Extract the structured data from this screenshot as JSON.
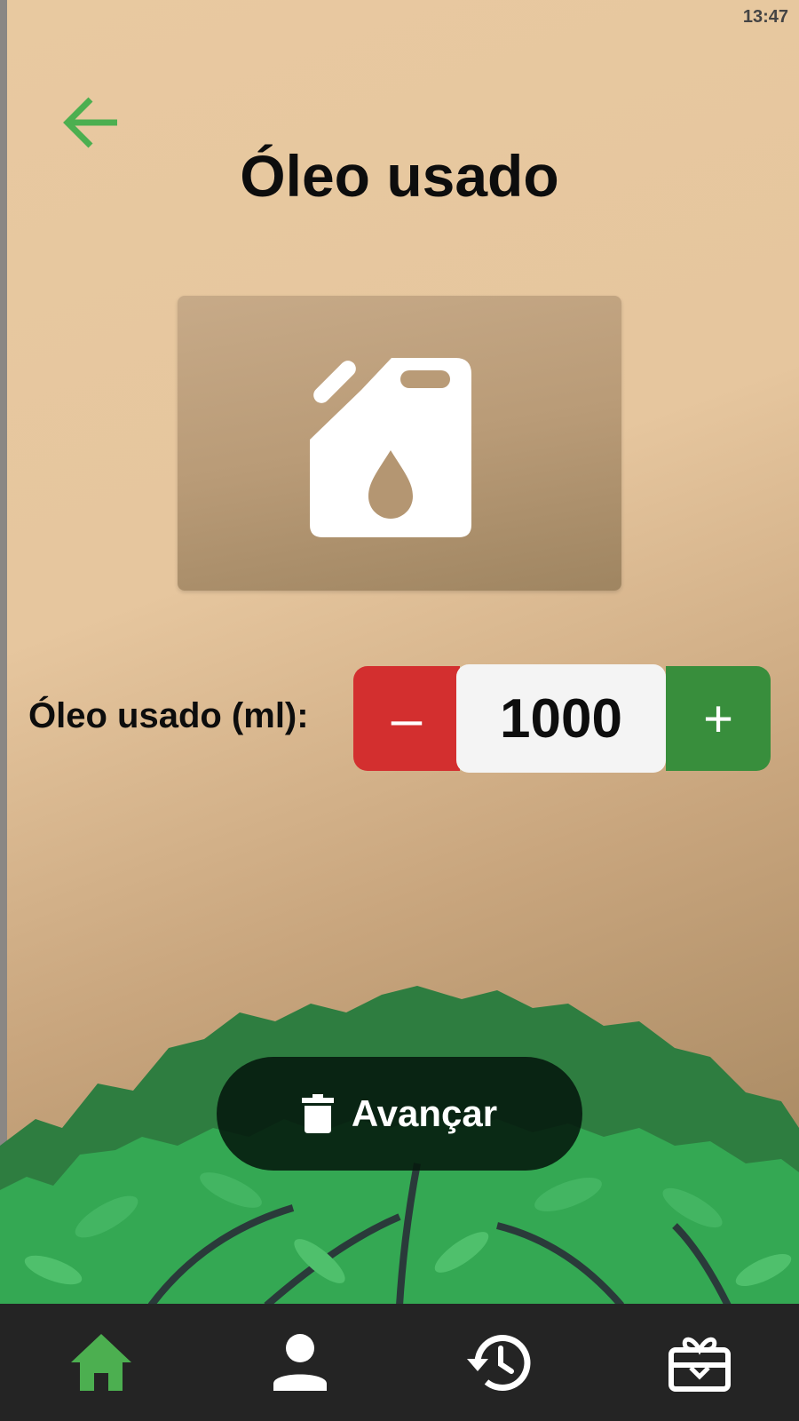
{
  "status_bar": {
    "time": "13:47"
  },
  "header": {
    "title": "Óleo usado",
    "back_icon": "arrow-left-icon"
  },
  "hero": {
    "icon": "oil-jerrycan-icon"
  },
  "quantity": {
    "label": "Óleo usado (ml):",
    "value": "1000",
    "decrement_label": "–",
    "increment_label": "+"
  },
  "actions": {
    "advance_label": "Avançar",
    "advance_icon": "trash-icon"
  },
  "bottom_nav": {
    "items": [
      {
        "name": "home",
        "icon": "home-icon",
        "active": true
      },
      {
        "name": "profile",
        "icon": "person-icon",
        "active": false
      },
      {
        "name": "history",
        "icon": "history-icon",
        "active": false
      },
      {
        "name": "rewards",
        "icon": "gift-card-icon",
        "active": false
      }
    ]
  },
  "colors": {
    "accent_green": "#4caf50",
    "decrement_red": "#d32f2f",
    "increment_green": "#388e3c",
    "nav_background": "#242424"
  }
}
